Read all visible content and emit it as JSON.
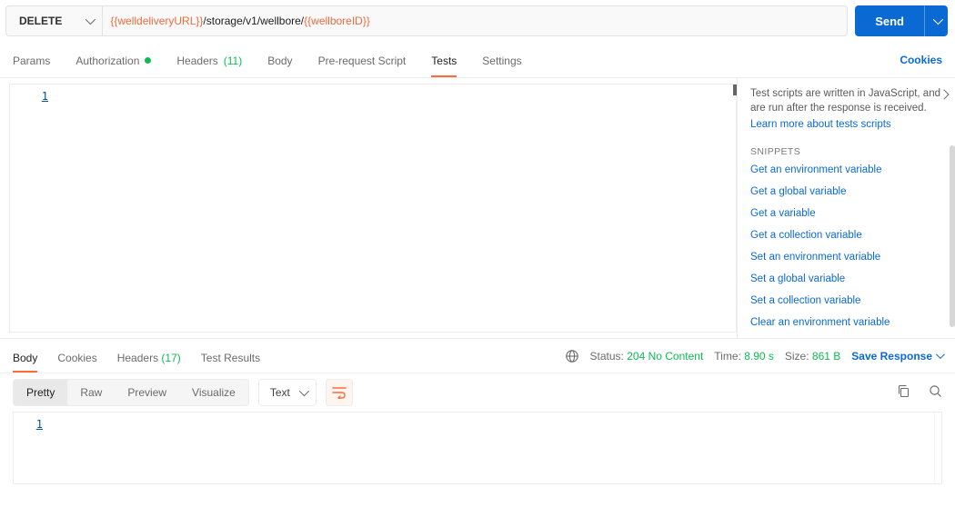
{
  "request": {
    "method": "DELETE",
    "url_var1": "{{welldeliveryURL}}",
    "url_mid": "/storage/v1/wellbore/",
    "url_var2": "{{wellboreID}}",
    "send_label": "Send"
  },
  "tabs": {
    "params": "Params",
    "auth": "Authorization",
    "headers": "Headers",
    "headers_count": "(11)",
    "body": "Body",
    "prereq": "Pre-request Script",
    "tests": "Tests",
    "settings": "Settings",
    "cookies": "Cookies"
  },
  "editor": {
    "line1": "1"
  },
  "snippets": {
    "hint": "Test scripts are written in JavaScript, and are run after the response is received.",
    "learn": "Learn more about tests scripts",
    "title": "SNIPPETS",
    "list": [
      "Get an environment variable",
      "Get a global variable",
      "Get a variable",
      "Get a collection variable",
      "Set an environment variable",
      "Set a global variable",
      "Set a collection variable",
      "Clear an environment variable"
    ]
  },
  "response": {
    "tabs": {
      "body": "Body",
      "cookies": "Cookies",
      "headers": "Headers",
      "headers_count": "(17)",
      "test_results": "Test Results"
    },
    "status_label": "Status:",
    "status_value": "204 No Content",
    "time_label": "Time:",
    "time_value": "8.90 s",
    "size_label": "Size:",
    "size_value": "861 B",
    "save_label": "Save Response"
  },
  "view": {
    "pretty": "Pretty",
    "raw": "Raw",
    "preview": "Preview",
    "visualize": "Visualize",
    "format": "Text"
  },
  "resp_editor": {
    "line1": "1"
  }
}
